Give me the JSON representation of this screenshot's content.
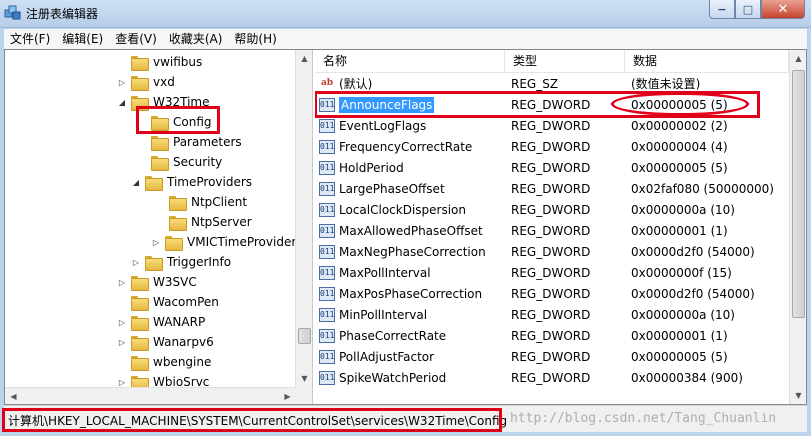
{
  "window": {
    "title": "注册表编辑器",
    "minimize_glyph": "−",
    "maximize_glyph": "□",
    "close_glyph": "✕"
  },
  "menu": [
    "文件(F)",
    "编辑(E)",
    "查看(V)",
    "收藏夹(A)",
    "帮助(H)"
  ],
  "tree": {
    "items": [
      {
        "label": "vwifibus",
        "expander": ""
      },
      {
        "label": "vxd",
        "expander": "▷"
      },
      {
        "label": "W32Time",
        "expander": "◢"
      },
      {
        "label": "Config",
        "expander": ""
      },
      {
        "label": "Parameters",
        "expander": ""
      },
      {
        "label": "Security",
        "expander": ""
      },
      {
        "label": "TimeProviders",
        "expander": "◢"
      },
      {
        "label": "NtpClient",
        "expander": ""
      },
      {
        "label": "NtpServer",
        "expander": ""
      },
      {
        "label": "VMICTimeProvider",
        "expander": "▷"
      },
      {
        "label": "TriggerInfo",
        "expander": "▷"
      },
      {
        "label": "W3SVC",
        "expander": "▷"
      },
      {
        "label": "WacomPen",
        "expander": ""
      },
      {
        "label": "WANARP",
        "expander": "▷"
      },
      {
        "label": "Wanarpv6",
        "expander": "▷"
      },
      {
        "label": "wbengine",
        "expander": ""
      },
      {
        "label": "WbioSrvc",
        "expander": "▷"
      }
    ]
  },
  "list": {
    "columns": [
      "名称",
      "类型",
      "数据"
    ],
    "rows": [
      {
        "name": "(默认)",
        "type": "REG_SZ",
        "data": "(数值未设置)",
        "icon": "ab"
      },
      {
        "name": "AnnounceFlags",
        "type": "REG_DWORD",
        "data": "0x00000005 (5)",
        "icon": "011"
      },
      {
        "name": "EventLogFlags",
        "type": "REG_DWORD",
        "data": "0x00000002 (2)",
        "icon": "011"
      },
      {
        "name": "FrequencyCorrectRate",
        "type": "REG_DWORD",
        "data": "0x00000004 (4)",
        "icon": "011"
      },
      {
        "name": "HoldPeriod",
        "type": "REG_DWORD",
        "data": "0x00000005 (5)",
        "icon": "011"
      },
      {
        "name": "LargePhaseOffset",
        "type": "REG_DWORD",
        "data": "0x02faf080 (50000000)",
        "icon": "011"
      },
      {
        "name": "LocalClockDispersion",
        "type": "REG_DWORD",
        "data": "0x0000000a (10)",
        "icon": "011"
      },
      {
        "name": "MaxAllowedPhaseOffset",
        "type": "REG_DWORD",
        "data": "0x00000001 (1)",
        "icon": "011"
      },
      {
        "name": "MaxNegPhaseCorrection",
        "type": "REG_DWORD",
        "data": "0x0000d2f0 (54000)",
        "icon": "011"
      },
      {
        "name": "MaxPollInterval",
        "type": "REG_DWORD",
        "data": "0x0000000f (15)",
        "icon": "011"
      },
      {
        "name": "MaxPosPhaseCorrection",
        "type": "REG_DWORD",
        "data": "0x0000d2f0 (54000)",
        "icon": "011"
      },
      {
        "name": "MinPollInterval",
        "type": "REG_DWORD",
        "data": "0x0000000a (10)",
        "icon": "011"
      },
      {
        "name": "PhaseCorrectRate",
        "type": "REG_DWORD",
        "data": "0x00000001 (1)",
        "icon": "011"
      },
      {
        "name": "PollAdjustFactor",
        "type": "REG_DWORD",
        "data": "0x00000005 (5)",
        "icon": "011"
      },
      {
        "name": "SpikeWatchPeriod",
        "type": "REG_DWORD",
        "data": "0x00000384 (900)",
        "icon": "011"
      }
    ]
  },
  "status": {
    "path": "计算机\\HKEY_LOCAL_MACHINE\\SYSTEM\\CurrentControlSet\\services\\W32Time\\Config",
    "watermark": "http://blog.csdn.net/Tang_Chuanlin"
  },
  "colors": {
    "highlight": "#e0001a",
    "selection": "#3399ff"
  }
}
